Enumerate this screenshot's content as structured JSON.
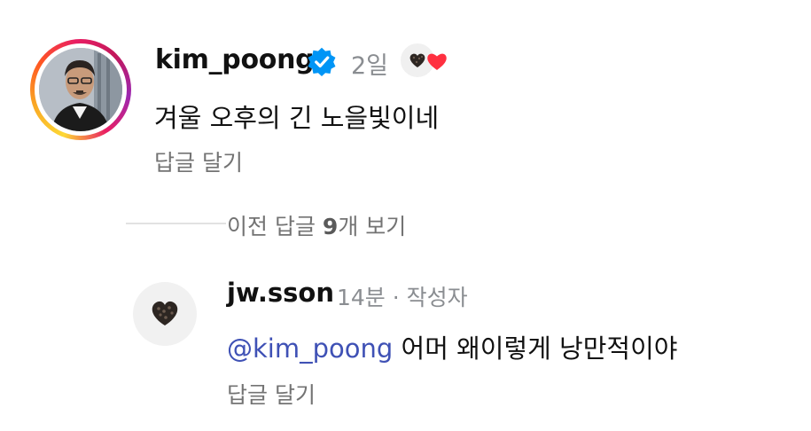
{
  "comment": {
    "username": "kim_poong",
    "time": "2일",
    "text": "겨울 오후의 긴 노을빛이네",
    "reply_label": "답글 달기",
    "verified_icon": "verified-badge-icon",
    "liked_by_author_icon": "heart-icon"
  },
  "replies_toggle": {
    "prefix": "이전 답글 ",
    "count": "9",
    "suffix": "개 보기"
  },
  "reply": {
    "username": "jw.sson",
    "meta": "14분 · 작성자",
    "mention": "@kim_poong",
    "text": " 어머 왜이렇게 낭만적이야",
    "reply_label": "답글 달기"
  },
  "colors": {
    "verified": "#0095f6",
    "heart": "#ff3040",
    "mention": "#3f51b5",
    "muted": "#737373"
  }
}
